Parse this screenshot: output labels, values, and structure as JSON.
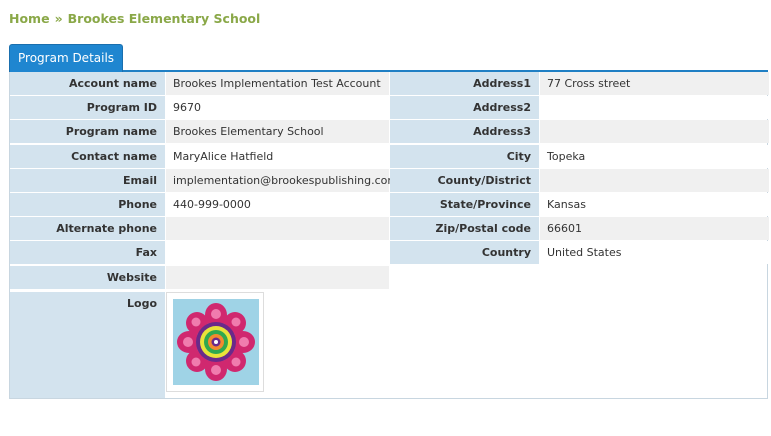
{
  "breadcrumb": {
    "home": "Home",
    "separator": "»",
    "current": "Brookes Elementary School"
  },
  "tabs": [
    {
      "label": "Program Details"
    }
  ],
  "left_fields": [
    {
      "label": "Account name",
      "value": "Brookes Implementation Test Account"
    },
    {
      "label": "Program ID",
      "value": "9670"
    },
    {
      "label": "Program name",
      "value": "Brookes Elementary School"
    },
    {
      "label": "Contact name",
      "value": "MaryAlice Hatfield"
    },
    {
      "label": "Email",
      "value": "implementation@brookespublishing.com"
    },
    {
      "label": "Phone",
      "value": "440-999-0000"
    },
    {
      "label": "Alternate phone",
      "value": ""
    },
    {
      "label": "Fax",
      "value": ""
    },
    {
      "label": "Website",
      "value": ""
    }
  ],
  "right_fields": [
    {
      "label": "Address1",
      "value": "77 Cross street"
    },
    {
      "label": "Address2",
      "value": ""
    },
    {
      "label": "Address3",
      "value": ""
    },
    {
      "label": "City",
      "value": "Topeka"
    },
    {
      "label": "County/District",
      "value": ""
    },
    {
      "label": "State/Province",
      "value": "Kansas"
    },
    {
      "label": "Zip/Postal code",
      "value": "66601"
    },
    {
      "label": "Country",
      "value": "United States"
    }
  ],
  "logo": {
    "label": "Logo",
    "image": "mandala-logo"
  },
  "colors": {
    "breadcrumb": "#8aa848",
    "tab": "#1f86d0",
    "label_bg": "#d3e3ee",
    "row_alt": "#f0f0f0"
  }
}
